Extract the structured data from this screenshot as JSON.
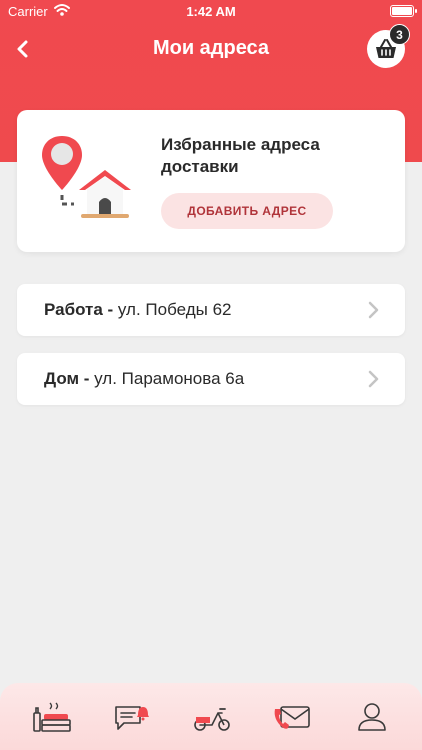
{
  "status_bar": {
    "carrier": "Carrier",
    "time": "1:42 AM"
  },
  "header": {
    "title": "Мои адреса",
    "basket_count": "3"
  },
  "favorites_card": {
    "title": "Избранные адреса доставки",
    "add_button_label": "ДОБАВИТЬ АДРЕС"
  },
  "addresses": [
    {
      "name": "Работа -",
      "address": " ул. Победы 62"
    },
    {
      "name": "Дом -",
      "address": " ул. Парамонова 6а"
    }
  ],
  "tab_bar": {
    "tabs": [
      "menu-icon",
      "chat-icon",
      "scooter-icon",
      "phone-icon",
      "profile-icon"
    ]
  },
  "colors": {
    "accent": "#f0494f",
    "accent_button_bg": "#fbe3e3",
    "accent_button_text": "#b0343a",
    "background": "#efefef"
  }
}
